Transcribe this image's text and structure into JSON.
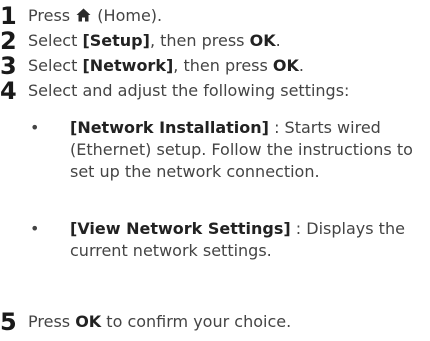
{
  "steps": [
    {
      "num": "1",
      "pre": "Press ",
      "icon": "home-icon",
      "post_bold": "(Home)",
      "post": "."
    },
    {
      "num": "2",
      "pre": "Select ",
      "bold": "[Setup]",
      "mid": ", then press ",
      "bold2": "OK",
      "post": "."
    },
    {
      "num": "3",
      "pre": "Select ",
      "bold": "[Network]",
      "mid": ", then press ",
      "bold2": "OK",
      "post": "."
    },
    {
      "num": "4",
      "text": "Select and adjust the following settings:"
    },
    {
      "num": "5",
      "pre": "Press ",
      "bold": "OK",
      "post": " to confirm your choice."
    }
  ],
  "bullets": [
    {
      "symbol": "•",
      "bold": "[Network Installation]",
      "text": " : Starts wired (Ethernet) setup. Follow the instructions to set up the network connection."
    },
    {
      "symbol": "•",
      "bold": "[View Network Settings]",
      "text": " : Displays the current network settings."
    }
  ]
}
